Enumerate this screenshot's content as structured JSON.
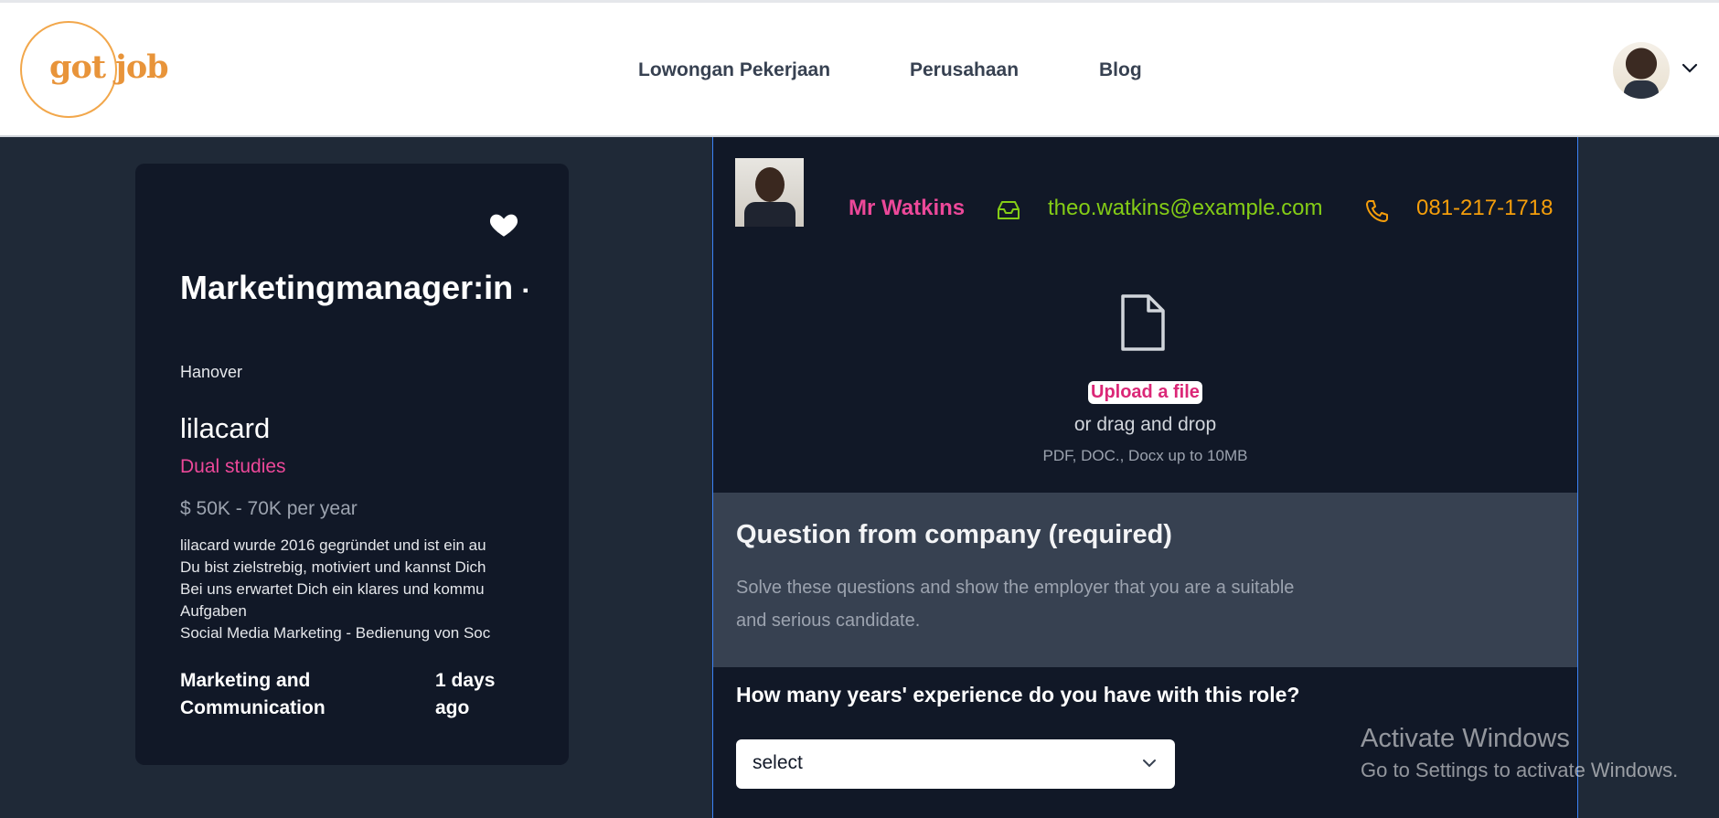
{
  "header": {
    "logo_text": "got job",
    "nav": [
      "Lowongan Pekerjaan",
      "Perusahaan",
      "Blog"
    ]
  },
  "job": {
    "title": "Marketingmanager:in - Duales Studium",
    "location": "Hanover",
    "company": "lilacard",
    "category": "Dual studies",
    "salary": "$ 50K - 70K per year",
    "description_lines": [
      "lilacard wurde 2016 gegründet und ist ein au",
      "Du bist zielstrebig, motiviert und kannst Dich",
      "Bei uns erwartet Dich ein klares und kommu",
      "Aufgaben",
      "Social Media Marketing - Bedienung von Soc"
    ],
    "department": "Marketing and Communication",
    "posted": "1 days ago"
  },
  "applicant": {
    "name": "Mr Watkins",
    "email": "theo.watkins@example.com",
    "phone": "081-217-1718"
  },
  "upload": {
    "button": "Upload a file",
    "hint": "or drag and drop",
    "types": "PDF, DOC., Docx up to 10MB"
  },
  "questions": {
    "title": "Question from company (required)",
    "subtitle": "Solve these questions and show the employer that you are a suitable and serious candidate.",
    "q1": "How many years' experience do you have with this role?",
    "q1_select": "select"
  },
  "watermark": {
    "line1": "Activate Windows",
    "line2": "Go to Settings to activate Windows."
  },
  "colors": {
    "accent_pink": "#ec4899",
    "accent_green": "#84cc16",
    "accent_orange": "#f59e0b",
    "logo_orange": "#e8943a"
  }
}
